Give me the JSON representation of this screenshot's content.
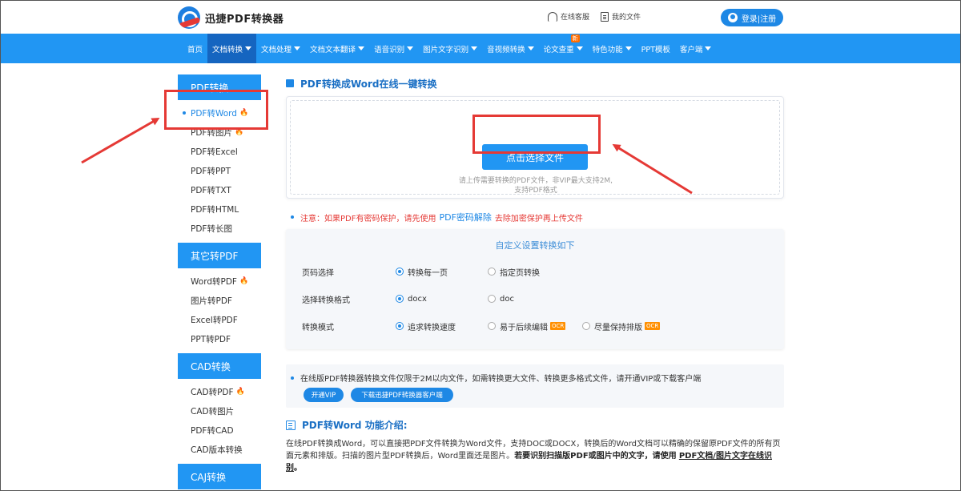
{
  "header": {
    "logo_text": "迅捷PDF转换器",
    "links": [
      "在线客服",
      "我的文件"
    ],
    "login_label": "登录|注册"
  },
  "nav": {
    "items": [
      {
        "label": "首页",
        "caret": false
      },
      {
        "label": "文档转换",
        "caret": true,
        "active": true
      },
      {
        "label": "文档处理",
        "caret": true
      },
      {
        "label": "文档文本翻译",
        "caret": true
      },
      {
        "label": "语音识别",
        "caret": true
      },
      {
        "label": "图片文字识别",
        "caret": true
      },
      {
        "label": "音视频转换",
        "caret": true
      },
      {
        "label": "论文查重",
        "caret": true,
        "badge": "新"
      },
      {
        "label": "特色功能",
        "caret": true
      },
      {
        "label": "PPT模板",
        "caret": false
      },
      {
        "label": "客户端",
        "caret": true
      }
    ]
  },
  "sidebar": {
    "sections": [
      {
        "title": "PDF转换",
        "items": [
          {
            "label": "PDF转Word",
            "hot": true,
            "active": true
          },
          {
            "label": "PDF转图片",
            "hot": true
          },
          {
            "label": "PDF转Excel"
          },
          {
            "label": "PDF转PPT"
          },
          {
            "label": "PDF转TXT"
          },
          {
            "label": "PDF转HTML"
          },
          {
            "label": "PDF转长图"
          }
        ]
      },
      {
        "title": "其它转PDF",
        "items": [
          {
            "label": "Word转PDF",
            "hot": true
          },
          {
            "label": "图片转PDF"
          },
          {
            "label": "Excel转PDF"
          },
          {
            "label": "PPT转PDF"
          }
        ]
      },
      {
        "title": "CAD转换",
        "items": [
          {
            "label": "CAD转PDF",
            "hot": true
          },
          {
            "label": "CAD转图片"
          },
          {
            "label": "PDF转CAD"
          },
          {
            "label": "CAD版本转换"
          }
        ]
      },
      {
        "title": "CAJ转换",
        "items": []
      }
    ]
  },
  "main": {
    "title": "PDF转换成Word在线一键转换",
    "upload": {
      "button_label": "点击选择文件",
      "hint_line1": "请上传需要转换的PDF文件，非VIP最大支持2M,",
      "hint_line2": "支持PDF格式"
    },
    "notice": {
      "prefix": "注意：如果PDF有密码保护，请先使用",
      "link": "PDF密码解除",
      "suffix": "去除加密保护再上传文件"
    },
    "settings": {
      "title": "自定义设置转换如下",
      "rows": [
        {
          "label": "页码选择",
          "options": [
            {
              "label": "转换每一页",
              "selected": true
            },
            {
              "label": "指定页转换",
              "selected": false
            }
          ]
        },
        {
          "label": "选择转换格式",
          "options": [
            {
              "label": "docx",
              "selected": true
            },
            {
              "label": "doc",
              "selected": false
            }
          ]
        },
        {
          "label": "转换模式",
          "options": [
            {
              "label": "追求转换速度",
              "selected": true
            },
            {
              "label": "易于后续编辑",
              "selected": false,
              "badge": "OCR"
            },
            {
              "label": "尽量保持排版",
              "selected": false,
              "badge": "OCR"
            }
          ]
        }
      ]
    },
    "vip": {
      "text": "在线版PDF转换器转换文件仅限于2M以内文件，如需转换更大文件、转换更多格式文件，请开通VIP或下载客户端",
      "btn_vip": "开通VIP",
      "btn_download": "下载迅捷PDF转换器客户端"
    },
    "intro": {
      "title": "PDF转Word 功能介绍:",
      "body_plain": "在线PDF转换成Word，可以直接把PDF文件转换为Word文件，支持DOC或DOCX，转换后的Word文档可以精确的保留原PDF文件的所有页面元素和排版。扫描的图片型PDF转换后，Word里面还是图片。",
      "body_bold": "若要识别扫描版PDF或图片中的文字，请使用",
      "body_link": "PDF文档/图片文字在线识别",
      "body_end": "。"
    }
  },
  "colors": {
    "nav_bg": "#2196f3",
    "nav_active": "#1565c0",
    "accent": "#1e88e5",
    "annotation": "#e53935",
    "hot": "#ff6d00"
  }
}
